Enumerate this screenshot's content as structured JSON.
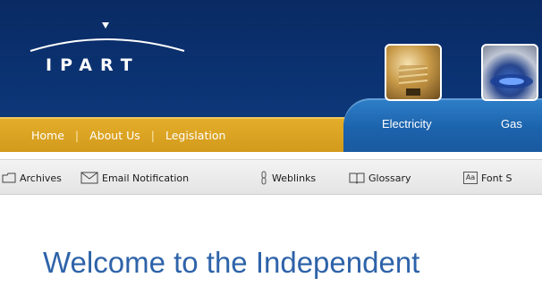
{
  "logo": {
    "text": "IPART",
    "icon": "ipart-logo-icon"
  },
  "nav": {
    "items": [
      {
        "label": "Home"
      },
      {
        "label": "About Us"
      },
      {
        "label": "Legislation"
      }
    ],
    "separator": "|"
  },
  "tabs": [
    {
      "label": "Electricity",
      "icon": "light-bulb-icon"
    },
    {
      "label": "Gas",
      "icon": "gas-burner-icon"
    }
  ],
  "toolbar": {
    "items": [
      {
        "label": "Archives",
        "icon": "folder-icon"
      },
      {
        "label": "Email Notification",
        "icon": "envelope-icon"
      },
      {
        "label": "Weblinks",
        "icon": "chain-link-icon"
      },
      {
        "label": "Glossary",
        "icon": "book-icon"
      },
      {
        "label": "Font S",
        "icon": "font-size-icon",
        "icon_text": "Aa"
      }
    ]
  },
  "main": {
    "heading": "Welcome to the Independent"
  },
  "colors": {
    "header_navy": "#0b3373",
    "nav_gold": "#d9a21f",
    "tab_blue": "#1f66b0",
    "heading_blue": "#2e63a9"
  }
}
